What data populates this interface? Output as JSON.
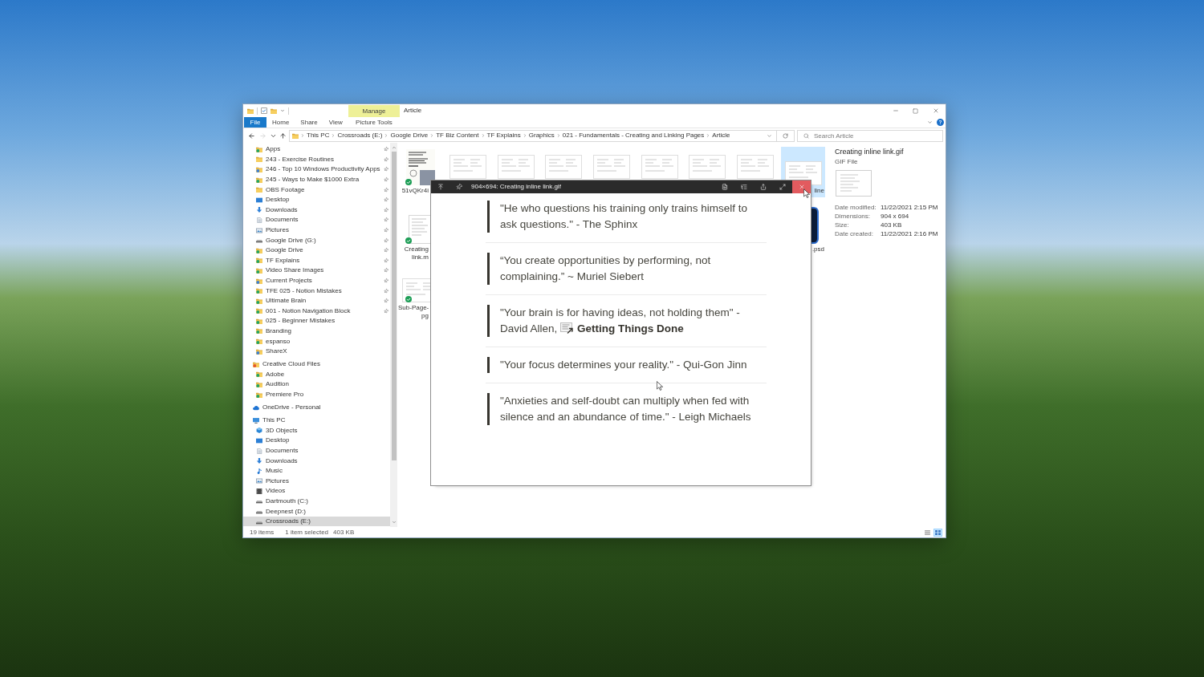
{
  "window": {
    "title": "Article"
  },
  "ribbon": {
    "group_header": "Manage",
    "tabs": [
      {
        "label": "File",
        "kind": "file"
      },
      {
        "label": "Home",
        "kind": "tab"
      },
      {
        "label": "Share",
        "kind": "tab"
      },
      {
        "label": "View",
        "kind": "tab"
      },
      {
        "label": "Picture Tools",
        "kind": "contextual"
      }
    ]
  },
  "navigation": [
    {
      "kind": "back",
      "disabled": false
    },
    {
      "kind": "forward",
      "disabled": true
    },
    {
      "kind": "recent",
      "disabled": false
    },
    {
      "kind": "up",
      "disabled": false
    }
  ],
  "address_bar": {
    "crumbs": [
      "This PC",
      "Crossroads (E:)",
      "Google Drive",
      "TF Biz Content",
      "TF Explains",
      "Graphics",
      "021 - Fundamentals - Creating and Linking Pages",
      "Article"
    ]
  },
  "search": {
    "placeholder": "Search Article"
  },
  "sidebar": {
    "quick_access": [
      {
        "label": "Apps",
        "kind": "synced-folder",
        "pinned": true,
        "selected": false
      },
      {
        "label": "243 - Exercise Routines",
        "kind": "folder",
        "pinned": true,
        "selected": false
      },
      {
        "label": "246 - Top 10 Windows Productivity Apps",
        "kind": "shared-folder",
        "pinned": true,
        "selected": false
      },
      {
        "label": "245 - Ways to Make $1000 Extra",
        "kind": "synced-folder",
        "pinned": true,
        "selected": false
      },
      {
        "label": "OBS Footage",
        "kind": "folder",
        "pinned": true,
        "selected": false
      },
      {
        "label": "Desktop",
        "kind": "desktop",
        "pinned": true,
        "selected": false
      },
      {
        "label": "Downloads",
        "kind": "downloads",
        "pinned": true,
        "selected": false
      },
      {
        "label": "Documents",
        "kind": "documents",
        "pinned": true,
        "selected": false
      },
      {
        "label": "Pictures",
        "kind": "pictures",
        "pinned": true,
        "selected": false
      },
      {
        "label": "Google Drive (G:)",
        "kind": "drive",
        "pinned": true,
        "selected": false
      },
      {
        "label": "Google Drive",
        "kind": "synced-folder",
        "pinned": true,
        "selected": false
      },
      {
        "label": "TF Explains",
        "kind": "synced-folder",
        "pinned": true,
        "selected": false
      },
      {
        "label": "Video Share Images",
        "kind": "synced-folder",
        "pinned": true,
        "selected": false
      },
      {
        "label": "Current Projects",
        "kind": "shared-folder",
        "pinned": true,
        "selected": false
      },
      {
        "label": "TFE 025 - Notion Mistakes",
        "kind": "synced-folder",
        "pinned": true,
        "selected": false
      },
      {
        "label": "Ultimate Brain",
        "kind": "synced-folder",
        "pinned": true,
        "selected": false
      },
      {
        "label": "001 - Notion Navigation Block",
        "kind": "synced-folder",
        "pinned": true,
        "selected": false
      },
      {
        "label": "025 - Beginner Mistakes",
        "kind": "synced-folder",
        "pinned": false,
        "selected": false
      },
      {
        "label": "Branding",
        "kind": "synced-folder",
        "pinned": false,
        "selected": false
      },
      {
        "label": "espanso",
        "kind": "synced-folder",
        "pinned": false,
        "selected": false
      },
      {
        "label": "ShareX",
        "kind": "shared-folder",
        "pinned": false,
        "selected": false
      }
    ],
    "locations": [
      {
        "label": "Creative Cloud Files",
        "kind": "badged-folder",
        "selected": false,
        "children": [
          {
            "label": "Adobe",
            "kind": "synced-folder",
            "selected": false
          },
          {
            "label": "Audition",
            "kind": "synced-folder",
            "selected": false
          },
          {
            "label": "Premiere Pro",
            "kind": "synced-folder",
            "selected": false
          }
        ]
      },
      {
        "label": "OneDrive - Personal",
        "kind": "cloud",
        "selected": false
      },
      {
        "label": "This PC",
        "kind": "computer",
        "selected": false,
        "children": [
          {
            "label": "3D Objects",
            "kind": "cube",
            "selected": false
          },
          {
            "label": "Desktop",
            "kind": "desktop",
            "selected": false
          },
          {
            "label": "Documents",
            "kind": "documents",
            "selected": false
          },
          {
            "label": "Downloads",
            "kind": "downloads",
            "selected": false
          },
          {
            "label": "Music",
            "kind": "music",
            "selected": false
          },
          {
            "label": "Pictures",
            "kind": "pictures",
            "selected": false
          },
          {
            "label": "Videos",
            "kind": "film",
            "selected": false
          },
          {
            "label": "Dartmouth (C:)",
            "kind": "drive",
            "selected": false
          },
          {
            "label": "Deepnest (D:)",
            "kind": "drive",
            "selected": false
          },
          {
            "label": "Crossroads (E:)",
            "kind": "drive",
            "selected": true
          }
        ]
      }
    ]
  },
  "files": {
    "rows": [
      {
        "items": [
          {
            "kind": "cover",
            "label_lines": [
              "51vQKr4i"
            ],
            "synced": true,
            "selected": false
          },
          {
            "kind": "screenshot",
            "selected": false
          },
          {
            "kind": "screenshot",
            "selected": false
          },
          {
            "kind": "screenshot",
            "selected": false
          },
          {
            "kind": "screenshot",
            "selected": false
          },
          {
            "kind": "screenshot",
            "selected": false
          },
          {
            "kind": "screenshot",
            "selected": false
          },
          {
            "kind": "screenshot",
            "selected": false
          },
          {
            "kind": "screenshot",
            "label_lines": [
              "line"
            ],
            "selected": true
          }
        ]
      },
      {
        "items": [
          {
            "kind": "document",
            "label_lines": [
              "Creating",
              "link.m"
            ],
            "synced": true,
            "selected": false
          },
          {
            "kind": "psd",
            "label_lines": [
              ".psd"
            ],
            "selected": false
          }
        ]
      },
      {
        "items": [
          {
            "kind": "screenshot",
            "label_lines": [
              "Sub-Page-",
              "pg"
            ],
            "synced": true,
            "selected": false
          }
        ]
      }
    ]
  },
  "preview": {
    "title": "904×694: Creating inline link.gif",
    "close_hovered": true,
    "quotes": [
      {
        "text": "\"He who questions his training only trains himself to ask questions.\" - The Sphinx"
      },
      {
        "text": "“You create opportunities by performing, not complaining.” ~ Muriel Siebert"
      },
      {
        "text": "\"Your brain is for having ideas, not holding them\" - David Allen,",
        "link": "Getting Things Done"
      },
      {
        "text": "\"Your focus determines your reality.\" - Qui-Gon Jinn"
      },
      {
        "text": "\"Anxieties and self-doubt can multiply when fed with silence and an abundance of time.\" - Leigh Michaels"
      }
    ]
  },
  "details": {
    "name": "Creating inline link.gif",
    "type": "GIF File",
    "properties": [
      {
        "label": "Date modified:",
        "value": "11/22/2021 2:15 PM"
      },
      {
        "label": "Dimensions:",
        "value": "904 x 694"
      },
      {
        "label": "Size:",
        "value": "403 KB"
      },
      {
        "label": "Date created:",
        "value": "11/22/2021 2:16 PM"
      }
    ]
  },
  "status_bar": {
    "item_count": "19 items",
    "selection": "1 item selected",
    "selection_size": "403 KB",
    "views": [
      {
        "kind": "details",
        "selected": false
      },
      {
        "kind": "large-icons",
        "selected": true
      }
    ]
  }
}
